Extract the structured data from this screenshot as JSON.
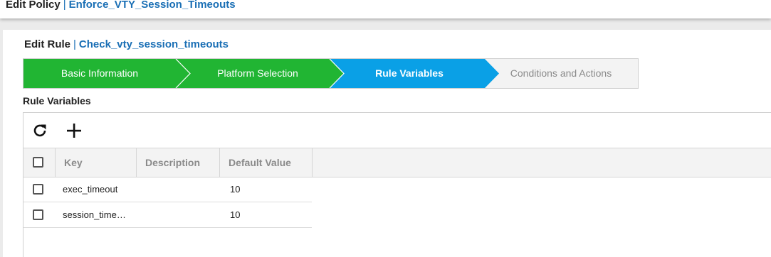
{
  "header": {
    "label": "Edit Policy",
    "separator": "|",
    "policy_name": "Enforce_VTY_Session_Timeouts"
  },
  "rule": {
    "label": "Edit Rule",
    "separator": "|",
    "rule_name": "Check_vty_session_timeouts"
  },
  "wizard": {
    "steps": [
      {
        "label": "Basic Information",
        "state": "completed"
      },
      {
        "label": "Platform Selection",
        "state": "completed"
      },
      {
        "label": "Rule Variables",
        "state": "active"
      },
      {
        "label": "Conditions and Actions",
        "state": "pending"
      }
    ],
    "colors": {
      "completed": "#21b533",
      "active": "#0aa0e6",
      "pending": "#f3f3f3",
      "pending_text": "#8a8a8a"
    }
  },
  "section_label": "Rule Variables",
  "toolbar": {
    "refresh_icon": "refresh-icon",
    "add_icon": "plus-icon"
  },
  "table": {
    "columns": [
      "Key",
      "Description",
      "Default Value"
    ],
    "rows": [
      {
        "key": "exec_timeout",
        "description": "",
        "default_value": "10"
      },
      {
        "key": "session_time…",
        "description": "",
        "default_value": "10"
      }
    ]
  }
}
